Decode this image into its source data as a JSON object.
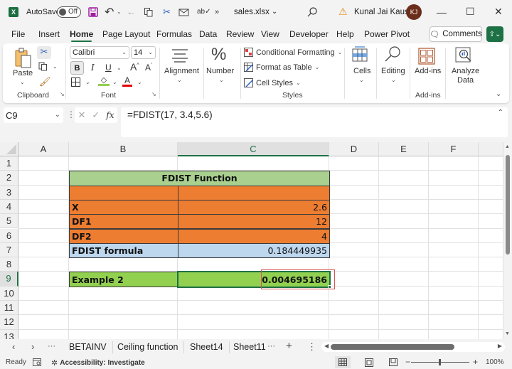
{
  "titlebar": {
    "app_icon": "excel-logo-icon",
    "app_letter": "X",
    "autosave_label": "AutoSave",
    "autosave_state": "Off",
    "filename": "sales.xlsx",
    "filename_chevron": "⌄",
    "more_label": "»",
    "user_name": "Kunal Jai Kaushik",
    "user_initials": "KJ",
    "warning_icon": "⚠",
    "minimize": "—",
    "maximize": "☐",
    "close": "✕"
  },
  "menu": {
    "tabs": [
      {
        "label": "File"
      },
      {
        "label": "Insert"
      },
      {
        "label": "Home",
        "active": true
      },
      {
        "label": "Page Layout"
      },
      {
        "label": "Formulas"
      },
      {
        "label": "Data"
      },
      {
        "label": "Review"
      },
      {
        "label": "View"
      },
      {
        "label": "Developer"
      },
      {
        "label": "Help"
      },
      {
        "label": "Power Pivot"
      }
    ],
    "comments_label": "Comments"
  },
  "ribbon": {
    "clipboard": {
      "paste_label": "Paste",
      "group_label": "Clipboard"
    },
    "font": {
      "font_name": "Calibri",
      "font_size": "14",
      "bold": "B",
      "italic": "I",
      "underline": "U",
      "grow": "A",
      "shrink": "A",
      "font_color_letter": "A",
      "group_label": "Font",
      "fill_color": "#92d050",
      "font_color": "#e00000"
    },
    "alignment_label": "Alignment",
    "number_label": "Number",
    "number_icon": "%",
    "styles": {
      "conditional_formatting": "Conditional Formatting",
      "format_as_table": "Format as Table",
      "cell_styles": "Cell Styles",
      "group_label": "Styles"
    },
    "cells_label": "Cells",
    "editing_label": "Editing",
    "addins_label": "Add-ins",
    "addins_group_label": "Add-ins",
    "analyze_label_1": "Analyze",
    "analyze_label_2": "Data"
  },
  "formula_bar": {
    "name_box": "C9",
    "cancel": "✕",
    "enter": "✓",
    "fx": "fx",
    "formula": "=FDIST(17, 3.4,5.6)"
  },
  "grid": {
    "columns": [
      "A",
      "B",
      "C",
      "D",
      "E",
      "F"
    ],
    "selected_column": "C",
    "rows": [
      "1",
      "2",
      "3",
      "4",
      "5",
      "6",
      "7",
      "8",
      "9",
      "10",
      "11",
      "12",
      "13"
    ],
    "selected_row": "9",
    "cells": {
      "title": "FDIST Function",
      "x_label": "X",
      "x_value": "2.6",
      "df1_label": "DF1",
      "df1_value": "12",
      "df2_label": "DF2",
      "df2_value": "4",
      "formula_label": "FDIST formula",
      "formula_value": "0.184449935",
      "example_label": "Example 2",
      "example_value": "0.004695186"
    },
    "colors": {
      "title_fill": "#a9d08e",
      "orange_fill": "#ed7d31",
      "blue_fill": "#bdd7ee",
      "green_fill": "#92d050",
      "highlight_box": "#d9534f",
      "accent": "#1e7145"
    }
  },
  "sheets": {
    "tabs": [
      "BETAINV",
      "Ceiling function",
      "Sheet14",
      "Sheet11"
    ],
    "more": "···",
    "add": "+",
    "options": "⋮"
  },
  "status": {
    "ready": "Ready",
    "accessibility": "Accessibility: Investigate",
    "zoom": "100%",
    "zoom_minus": "−",
    "zoom_plus": "+"
  }
}
